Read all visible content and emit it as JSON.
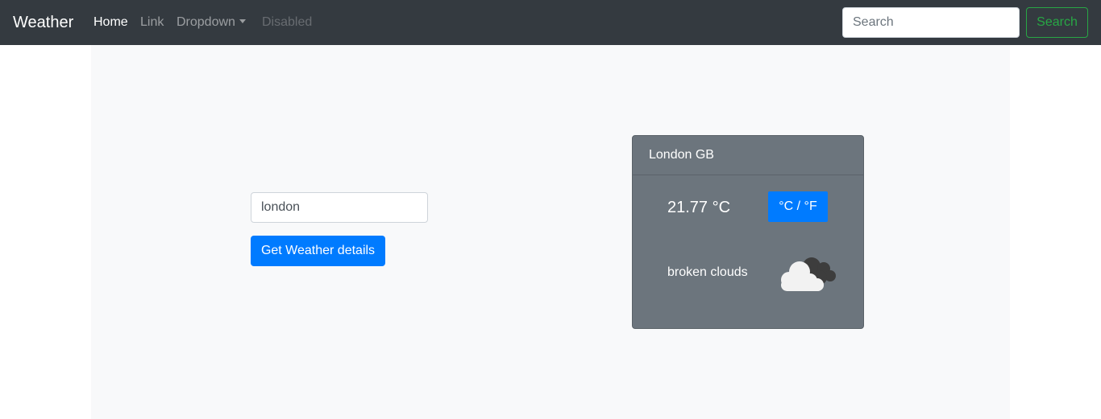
{
  "navbar": {
    "brand": "Weather",
    "links": [
      {
        "label": "Home",
        "state": "active"
      },
      {
        "label": "Link",
        "state": "normal"
      },
      {
        "label": "Dropdown",
        "state": "dropdown"
      },
      {
        "label": "Disabled",
        "state": "disabled"
      }
    ],
    "search": {
      "placeholder": "Search",
      "value": ""
    },
    "search_button": "Search"
  },
  "form": {
    "city_value": "london",
    "submit_label": "Get Weather details"
  },
  "weather_card": {
    "location": "London GB",
    "temperature": "21.77 °C",
    "unit_toggle": "°C / °F",
    "description": "broken clouds",
    "icon": "broken-clouds-icon"
  },
  "colors": {
    "navbar_bg": "#343a40",
    "primary": "#007bff",
    "success": "#28a745",
    "card_bg": "#6c757d",
    "container_bg": "#f8f9fa"
  }
}
